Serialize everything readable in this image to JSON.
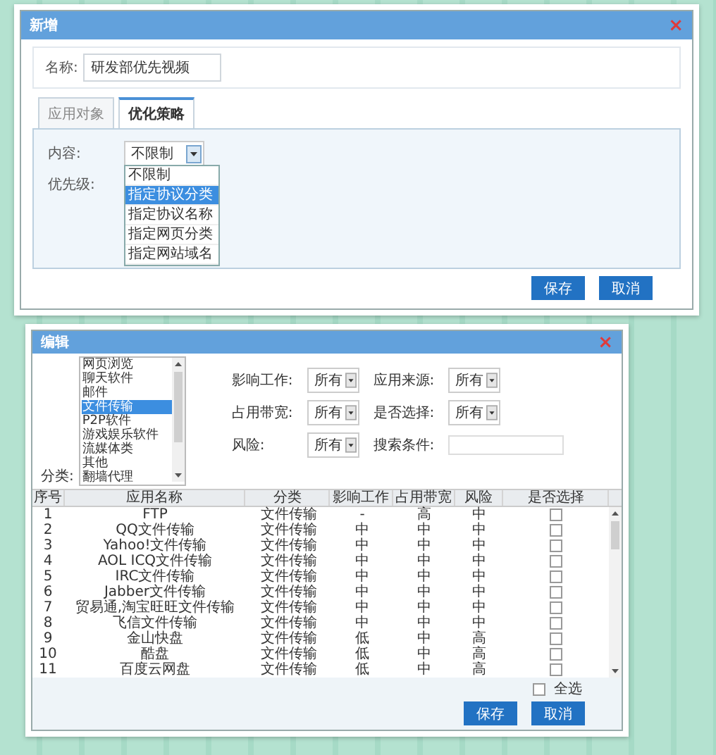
{
  "add_dialog": {
    "title": "新增",
    "close": "×",
    "name_label": "名称:",
    "name_value": "研发部优先视频",
    "tabs": [
      {
        "label": "应用对象",
        "selected": false
      },
      {
        "label": "优化策略",
        "selected": true
      }
    ],
    "content_label": "内容:",
    "content_value": "不限制",
    "options": [
      {
        "label": "不限制",
        "selected": false
      },
      {
        "label": "指定协议分类",
        "selected": true
      },
      {
        "label": "指定协议名称",
        "selected": false
      },
      {
        "label": "指定网页分类",
        "selected": false
      },
      {
        "label": "指定网站域名",
        "selected": false
      }
    ],
    "priority_label": "优先级:",
    "buttons": [
      "保存",
      "取消"
    ]
  },
  "edit_dialog": {
    "title": "编辑",
    "close": "×",
    "category_label": "分类:",
    "categories": [
      {
        "label": "网页浏览",
        "selected": false
      },
      {
        "label": "聊天软件",
        "selected": false
      },
      {
        "label": "邮件",
        "selected": false
      },
      {
        "label": "文件传输",
        "selected": true
      },
      {
        "label": "P2P软件",
        "selected": false
      },
      {
        "label": "游戏娱乐软件",
        "selected": false
      },
      {
        "label": "流媒体类",
        "selected": false
      },
      {
        "label": "其他",
        "selected": false
      },
      {
        "label": "翻墙代理",
        "selected": false
      }
    ],
    "filters": [
      {
        "kind": "select",
        "label": "影响工作:",
        "value": "所有"
      },
      {
        "kind": "select",
        "label": "应用来源:",
        "value": "所有"
      },
      {
        "kind": "select",
        "label": "占用带宽:",
        "value": "所有"
      },
      {
        "kind": "select",
        "label": "是否选择:",
        "value": "所有"
      },
      {
        "kind": "select",
        "label": "风险:",
        "value": "所有"
      },
      {
        "kind": "field",
        "label": "搜索条件:"
      }
    ],
    "columns": [
      "序号",
      "应用名称",
      "分类",
      "影响工作",
      "占用带宽",
      "风险",
      "是否选择"
    ],
    "rows": [
      {
        "cells": [
          "1",
          "FTP",
          "文件传输",
          "-",
          "高",
          "中"
        ],
        "checked": false
      },
      {
        "cells": [
          "2",
          "QQ文件传输",
          "文件传输",
          "中",
          "中",
          "中"
        ],
        "checked": false
      },
      {
        "cells": [
          "3",
          "Yahoo!文件传输",
          "文件传输",
          "中",
          "中",
          "中"
        ],
        "checked": false
      },
      {
        "cells": [
          "4",
          "AOL ICQ文件传输",
          "文件传输",
          "中",
          "中",
          "中"
        ],
        "checked": false
      },
      {
        "cells": [
          "5",
          "IRC文件传输",
          "文件传输",
          "中",
          "中",
          "中"
        ],
        "checked": false
      },
      {
        "cells": [
          "6",
          "Jabber文件传输",
          "文件传输",
          "中",
          "中",
          "中"
        ],
        "checked": false
      },
      {
        "cells": [
          "7",
          "贸易通,淘宝旺旺文件传输",
          "文件传输",
          "中",
          "中",
          "中"
        ],
        "checked": false
      },
      {
        "cells": [
          "8",
          "飞信文件传输",
          "文件传输",
          "中",
          "中",
          "中"
        ],
        "checked": false
      },
      {
        "cells": [
          "9",
          "金山快盘",
          "文件传输",
          "低",
          "中",
          "高"
        ],
        "checked": false
      },
      {
        "cells": [
          "10",
          "酷盘",
          "文件传输",
          "低",
          "中",
          "高"
        ],
        "checked": false
      },
      {
        "cells": [
          "11",
          "百度云网盘",
          "文件传输",
          "低",
          "中",
          "高"
        ],
        "checked": false
      }
    ],
    "select_all": {
      "label": "全选",
      "checked": false
    },
    "buttons": [
      "保存",
      "取消"
    ]
  }
}
